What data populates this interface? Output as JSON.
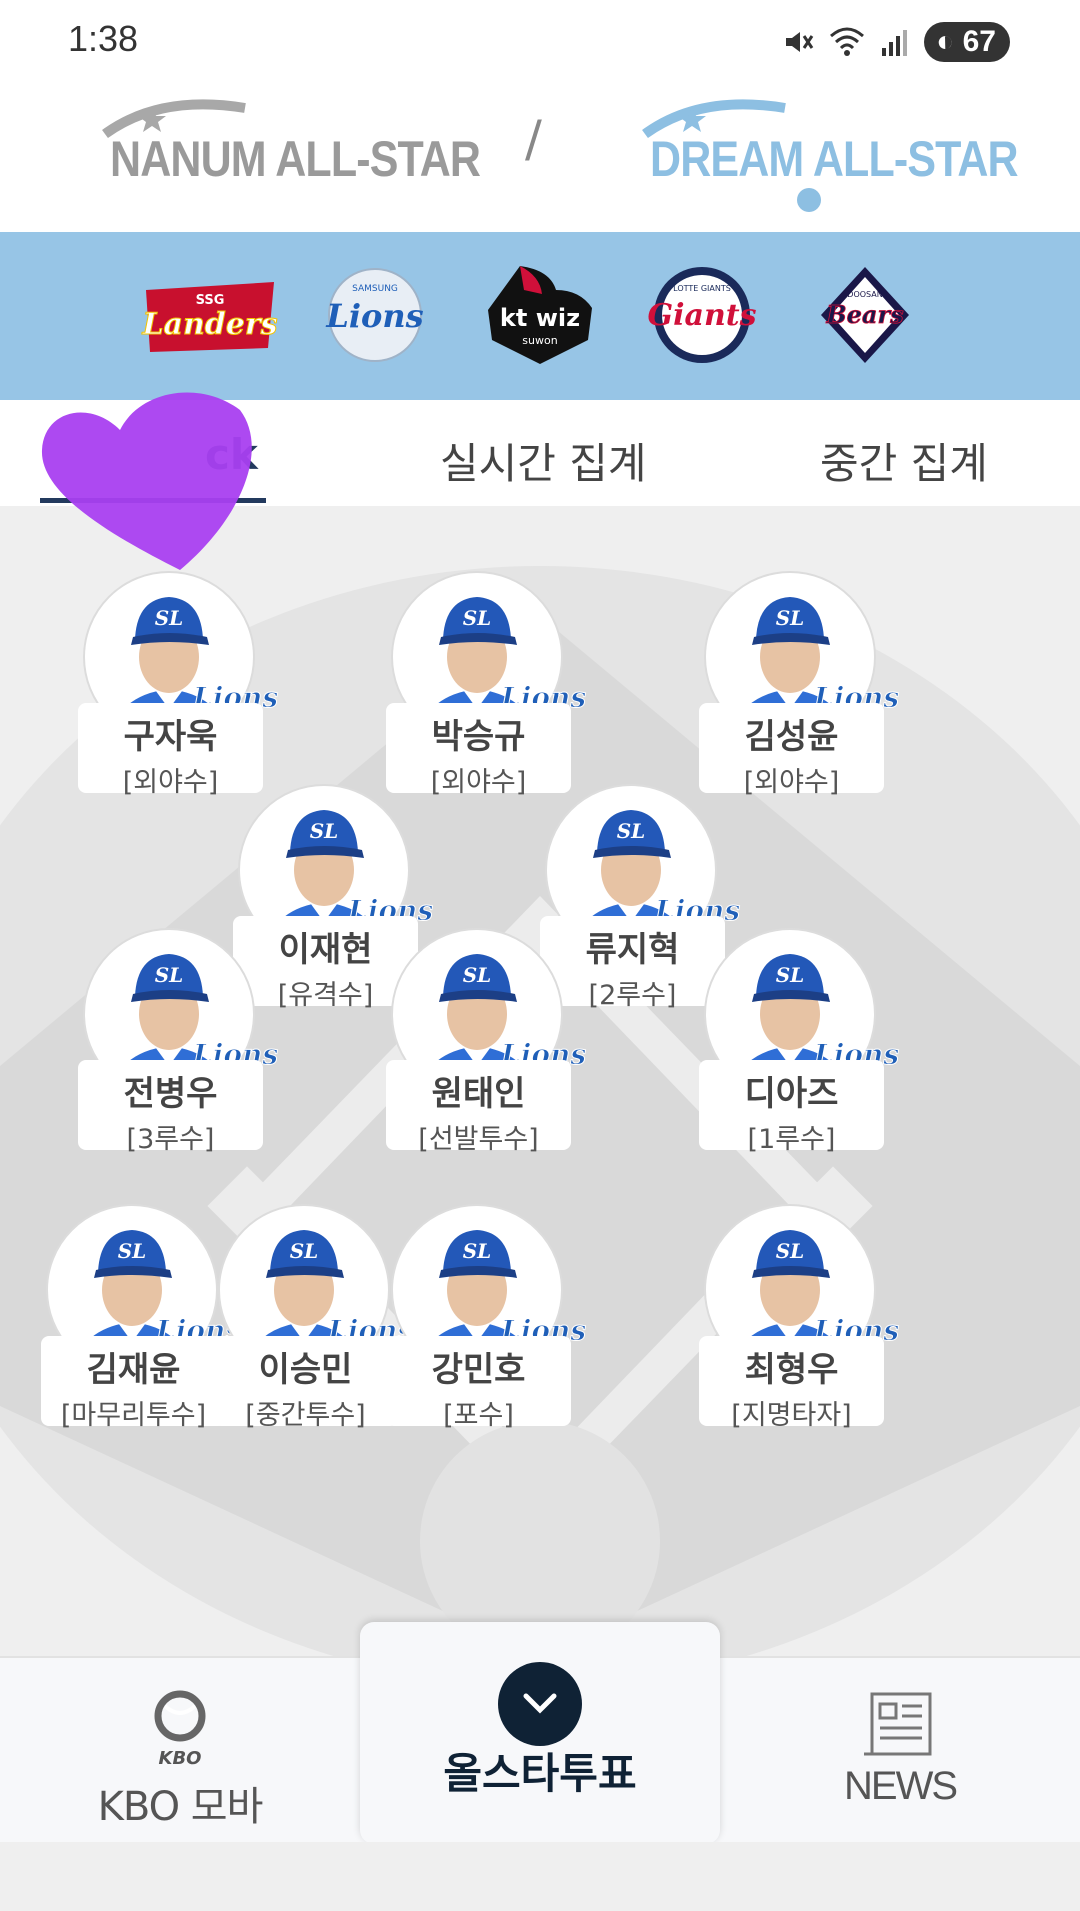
{
  "status_bar": {
    "time": "1:38",
    "battery": "67"
  },
  "header": {
    "leagues": [
      "NANUM ALL-STAR",
      "DREAM ALL-STAR"
    ],
    "separator": "/"
  },
  "teams": [
    {
      "name": "Landers",
      "sub": "SSG",
      "color": "#c8102e"
    },
    {
      "name": "Lions",
      "sub": "SAMSUNG",
      "color": "#1f5fb8"
    },
    {
      "name": "kt wiz",
      "sub": "suwon",
      "color": "#111111"
    },
    {
      "name": "Giants",
      "sub": "LOTTE GIANTS",
      "color": "#d0103a"
    },
    {
      "name": "Bears",
      "sub": "DOOSAN",
      "color": "#1a1748"
    }
  ],
  "tabs": [
    {
      "label": "ck",
      "active": true
    },
    {
      "label": "실시간 집계",
      "active": false
    },
    {
      "label": "중간 집계",
      "active": false
    }
  ],
  "players": [
    {
      "name": "구자욱",
      "position": "[외야수]"
    },
    {
      "name": "박승규",
      "position": "[외야수]"
    },
    {
      "name": "김성윤",
      "position": "[외야수]"
    },
    {
      "name": "이재현",
      "position": "[유격수]"
    },
    {
      "name": "류지혁",
      "position": "[2루수]"
    },
    {
      "name": "전병우",
      "position": "[3루수]"
    },
    {
      "name": "원태인",
      "position": "[선발투수]"
    },
    {
      "name": "디아즈",
      "position": "[1루수]"
    },
    {
      "name": "김재윤",
      "position": "[마무리투수]"
    },
    {
      "name": "이승민",
      "position": "[중간투수]"
    },
    {
      "name": "강민호",
      "position": "[포수]"
    },
    {
      "name": "최형우",
      "position": "[지명타자]"
    }
  ],
  "player_badge": "Lions",
  "bottom_nav": {
    "left_logo": "KBO",
    "left_label": "KBO 모바일",
    "center_label": "올스타투표",
    "right_label": "NEWS"
  },
  "colors": {
    "team_bar": "#97c5e6",
    "nav_active": "#0f2235",
    "dream": "#8dbfe2",
    "heart": "#a93ff0"
  }
}
